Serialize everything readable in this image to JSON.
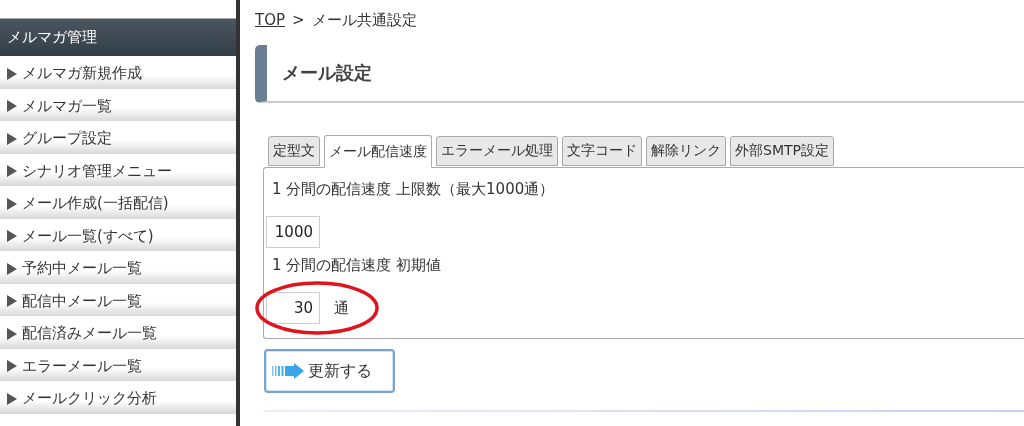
{
  "sidebar": {
    "title": "メルマガ管理",
    "items": [
      {
        "label": "メルマガ新規作成"
      },
      {
        "label": "メルマガ一覧"
      },
      {
        "label": "グループ設定"
      },
      {
        "label": "シナリオ管理メニュー"
      },
      {
        "label": "メール作成(一括配信)"
      },
      {
        "label": "メール一覧(すべて)"
      },
      {
        "label": "予約中メール一覧"
      },
      {
        "label": "配信中メール一覧"
      },
      {
        "label": "配信済みメール一覧"
      },
      {
        "label": "エラーメール一覧"
      },
      {
        "label": "メールクリック分析"
      }
    ]
  },
  "breadcrumb": {
    "link": "TOP",
    "separator": ">",
    "current": "メール共通設定"
  },
  "heading": "メール設定",
  "tabs": [
    {
      "label": "定型文",
      "selected": false
    },
    {
      "label": "メール配信速度",
      "selected": true
    },
    {
      "label": "エラーメール処理",
      "selected": false
    },
    {
      "label": "文字コード",
      "selected": false
    },
    {
      "label": "解除リンク",
      "selected": false
    },
    {
      "label": "外部SMTP設定",
      "selected": false
    }
  ],
  "fields": [
    {
      "label": "1 分間の配信速度 上限数（最大1000通）",
      "value": "1000",
      "highlighted": false
    },
    {
      "label": "1 分間の配信速度 初期値",
      "value": "30",
      "unit": "通",
      "highlighted": true
    }
  ],
  "submit_button": "更新する"
}
